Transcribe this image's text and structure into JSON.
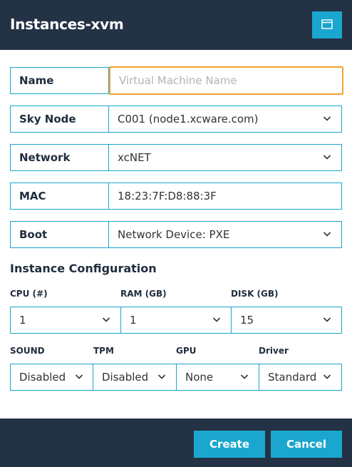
{
  "header": {
    "title": "Instances-xvm",
    "maximize_icon": "window-maximize-icon"
  },
  "form": {
    "name": {
      "label": "Name",
      "placeholder": "Virtual Machine Name",
      "value": ""
    },
    "sky_node": {
      "label": "Sky Node",
      "value": "C001 (node1.xcware.com)"
    },
    "network": {
      "label": "Network",
      "value": "xcNET"
    },
    "mac": {
      "label": "MAC",
      "value": "18:23:7F:D8:88:3F"
    },
    "boot": {
      "label": "Boot",
      "value": "Network Device: PXE"
    }
  },
  "instance_config": {
    "title": "Instance Configuration",
    "cpu": {
      "label": "CPU (#)",
      "value": "1"
    },
    "ram": {
      "label": "RAM (GB)",
      "value": "1"
    },
    "disk": {
      "label": "DISK (GB)",
      "value": "15"
    },
    "sound": {
      "label": "SOUND",
      "value": "Disabled"
    },
    "tpm": {
      "label": "TPM",
      "value": "Disabled"
    },
    "gpu": {
      "label": "GPU",
      "value": "None"
    },
    "driver": {
      "label": "Driver",
      "value": "Standard"
    }
  },
  "footer": {
    "create_label": "Create",
    "cancel_label": "Cancel"
  },
  "colors": {
    "header_bg": "#233245",
    "accent": "#1aa6cf",
    "focus": "#f0a22e"
  }
}
